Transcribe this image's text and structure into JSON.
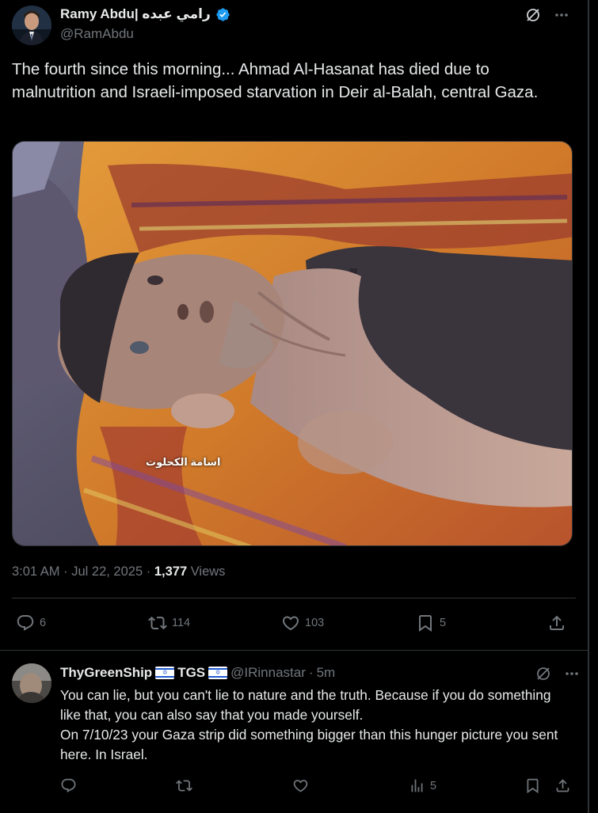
{
  "tweet": {
    "author_name": "Ramy Abdu| رامي عبده",
    "author_handle": "@RamAbdu",
    "text": "The fourth since this morning... Ahmad Al-Hasanat has died due to malnutrition and Israeli-imposed starvation in Deir al-Balah, central Gaza.",
    "media_caption": "اسامة الكحلوت",
    "time": "3:01 AM",
    "date": "Jul 22, 2025",
    "views_count": "1,377",
    "views_label": "Views",
    "actions": {
      "replies": "6",
      "reposts": "114",
      "likes": "103",
      "bookmarks": "5"
    }
  },
  "reply": {
    "author_name": "ThyGreenShip",
    "name_suffix": "TGS",
    "author_handle": "@IRinnastar",
    "time": "5m",
    "lines": [
      "You can lie, but you can't lie to nature and the truth. Because if you do something like that, you can also say that you made yourself.",
      "On 7/10/23 your Gaza strip did something bigger than this hunger picture you sent here. In Israel."
    ],
    "views": "5"
  },
  "colors": {
    "background": "#000000",
    "text": "#e7e9ea",
    "muted": "#71767b",
    "verified": "#1d9bf0",
    "divider": "#2f3336"
  },
  "icons": [
    "grok-icon",
    "more-icon",
    "reply-icon",
    "repost-icon",
    "like-icon",
    "bookmark-icon",
    "share-icon",
    "views-icon",
    "verified-icon"
  ]
}
